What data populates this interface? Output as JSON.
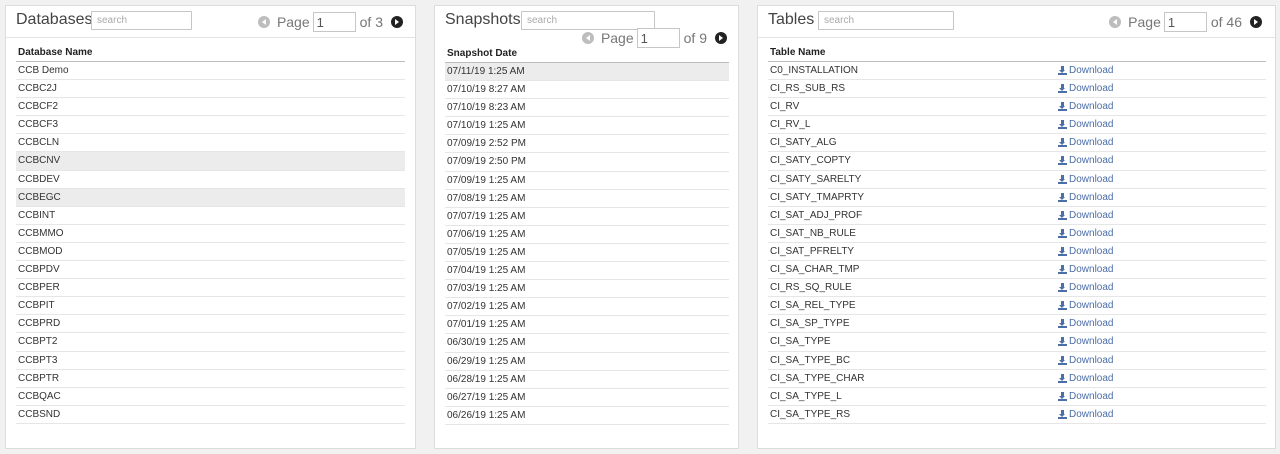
{
  "databases": {
    "title": "Databases",
    "search_placeholder": "search",
    "page_label": "Page",
    "page_value": "1",
    "page_total": "of 3",
    "column_header": "Database Name",
    "rows": [
      "CCB Demo",
      "CCBC2J",
      "CCBCF2",
      "CCBCF3",
      "CCBCLN",
      "CCBCNV",
      "CCBDEV",
      "CCBEGC",
      "CCBINT",
      "CCBMMO",
      "CCBMOD",
      "CCBPDV",
      "CCBPER",
      "CCBPIT",
      "CCBPRD",
      "CCBPT2",
      "CCBPT3",
      "CCBPTR",
      "CCBQAC",
      "CCBSND"
    ],
    "highlighted_rows": [
      5,
      7
    ]
  },
  "snapshots": {
    "title": "Snapshots",
    "search_placeholder": "search",
    "page_label": "Page",
    "page_value": "1",
    "page_total": "of 9",
    "column_header": "Snapshot Date",
    "rows": [
      "07/11/19 1:25 AM",
      "07/10/19 8:27 AM",
      "07/10/19 8:23 AM",
      "07/10/19 1:25 AM",
      "07/09/19 2:52 PM",
      "07/09/19 2:50 PM",
      "07/09/19 1:25 AM",
      "07/08/19 1:25 AM",
      "07/07/19 1:25 AM",
      "07/06/19 1:25 AM",
      "07/05/19 1:25 AM",
      "07/04/19 1:25 AM",
      "07/03/19 1:25 AM",
      "07/02/19 1:25 AM",
      "07/01/19 1:25 AM",
      "06/30/19 1:25 AM",
      "06/29/19 1:25 AM",
      "06/28/19 1:25 AM",
      "06/27/19 1:25 AM",
      "06/26/19 1:25 AM"
    ],
    "highlighted_rows": [
      0
    ]
  },
  "tables": {
    "title": "Tables",
    "search_placeholder": "search",
    "page_label": "Page",
    "page_value": "1",
    "page_total": "of 46",
    "column_header": "Table Name",
    "download_label": "Download",
    "rows": [
      "C0_INSTALLATION",
      "CI_RS_SUB_RS",
      "CI_RV",
      "CI_RV_L",
      "CI_SATY_ALG",
      "CI_SATY_COPTY",
      "CI_SATY_SARELTY",
      "CI_SATY_TMAPRTY",
      "CI_SAT_ADJ_PROF",
      "CI_SAT_NB_RULE",
      "CI_SAT_PFRELTY",
      "CI_SA_CHAR_TMP",
      "CI_RS_SQ_RULE",
      "CI_SA_REL_TYPE",
      "CI_SA_SP_TYPE",
      "CI_SA_TYPE",
      "CI_SA_TYPE_BC",
      "CI_SA_TYPE_CHAR",
      "CI_SA_TYPE_L",
      "CI_SA_TYPE_RS"
    ]
  },
  "colors": {
    "link": "#4b6ea8",
    "highlight": "#ececec",
    "background": "#f1f1f1"
  },
  "icons": {
    "prev": "chevron-left-circle-icon",
    "next": "chevron-right-circle-icon",
    "download": "download-icon"
  }
}
